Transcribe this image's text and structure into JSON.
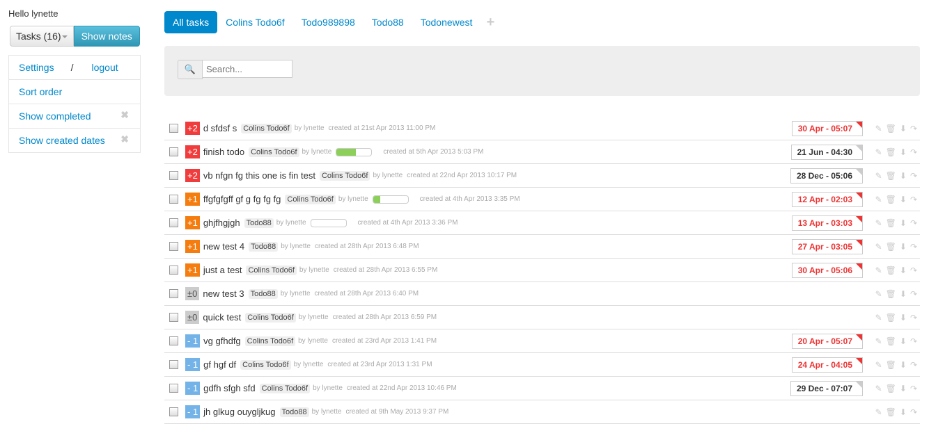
{
  "sidebar": {
    "greeting": "Hello lynette",
    "tasks_button": "Tasks (16)",
    "notes_button": "Show notes",
    "settings": "Settings",
    "separator": "/",
    "logout": "logout",
    "sort_order": "Sort order",
    "show_completed": "Show completed",
    "show_created_dates": "Show created dates"
  },
  "tabs": [
    {
      "label": "All tasks",
      "active": true
    },
    {
      "label": "Colins Todo6f"
    },
    {
      "label": "Todo989898"
    },
    {
      "label": "Todo88"
    },
    {
      "label": "Todonewest"
    }
  ],
  "search": {
    "placeholder": "Search..."
  },
  "colors": {
    "p2": "#f03c3c",
    "p1": "#f57c0e",
    "p0": "#cccccc",
    "m1": "#74b3e8",
    "overdue": "#ee3333"
  },
  "tasks": [
    {
      "priority": "+2",
      "level": "p2",
      "title": "d sfdsf s",
      "list": "Colins Todo6f",
      "by": "by lynette",
      "created": "created at 21st Apr 2013 11:00 PM",
      "due": "30 Apr - 05:07",
      "overdue": true
    },
    {
      "priority": "+2",
      "level": "p2",
      "title": "finish todo",
      "list": "Colins Todo6f",
      "by": "by lynette",
      "progress": 55,
      "created": "created at 5th Apr 2013 5:03 PM",
      "due": "21 Jun - 04:30",
      "overdue": false
    },
    {
      "priority": "+2",
      "level": "p2",
      "title": "vb nfgn fg this one is fin test",
      "list": "Colins Todo6f",
      "by": "by lynette",
      "created": "created at 22nd Apr 2013 10:17 PM",
      "due": "28 Dec - 05:06",
      "overdue": false
    },
    {
      "priority": "+1",
      "level": "p1",
      "title": "ffgfgfgff gf g fg fg fg",
      "list": "Colins Todo6f",
      "by": "by lynette",
      "progress": 20,
      "created": "created at 4th Apr 2013 3:35 PM",
      "due": "12 Apr - 02:03",
      "overdue": true
    },
    {
      "priority": "+1",
      "level": "p1",
      "title": "ghjfhgjgh",
      "list": "Todo88",
      "by": "by lynette",
      "progress": 0,
      "created": "created at 4th Apr 2013 3:36 PM",
      "due": "13 Apr - 03:03",
      "overdue": true
    },
    {
      "priority": "+1",
      "level": "p1",
      "title": "new test 4",
      "list": "Todo88",
      "by": "by lynette",
      "created": "created at 28th Apr 2013 6:48 PM",
      "due": "27 Apr - 03:05",
      "overdue": true
    },
    {
      "priority": "+1",
      "level": "p1",
      "title": "just a test",
      "list": "Colins Todo6f",
      "by": "by lynette",
      "created": "created at 28th Apr 2013 6:55 PM",
      "due": "30 Apr - 05:06",
      "overdue": true
    },
    {
      "priority": "±0",
      "level": "p0",
      "title": "new test 3",
      "list": "Todo88",
      "by": "by lynette",
      "created": "created at 28th Apr 2013 6:40 PM"
    },
    {
      "priority": "±0",
      "level": "p0",
      "title": "quick test",
      "list": "Colins Todo6f",
      "by": "by lynette",
      "created": "created at 28th Apr 2013 6:59 PM"
    },
    {
      "priority": "- 1",
      "level": "m1",
      "title": "vg gfhdfg",
      "list": "Colins Todo6f",
      "by": "by lynette",
      "created": "created at 23rd Apr 2013 1:41 PM",
      "due": "20 Apr - 05:07",
      "overdue": true
    },
    {
      "priority": "- 1",
      "level": "m1",
      "title": "gf hgf df",
      "list": "Colins Todo6f",
      "by": "by lynette",
      "created": "created at 23rd Apr 2013 1:31 PM",
      "due": "24 Apr - 04:05",
      "overdue": true
    },
    {
      "priority": "- 1",
      "level": "m1",
      "title": "gdfh sfgh sfd",
      "list": "Colins Todo6f",
      "by": "by lynette",
      "created": "created at 22nd Apr 2013 10:46 PM",
      "due": "29 Dec - 07:07",
      "overdue": false
    },
    {
      "priority": "- 1",
      "level": "m1",
      "title": "jh glkug ouygljkug",
      "list": "Todo88",
      "by": "by lynette",
      "created": "created at 9th May 2013 9:37 PM"
    }
  ]
}
